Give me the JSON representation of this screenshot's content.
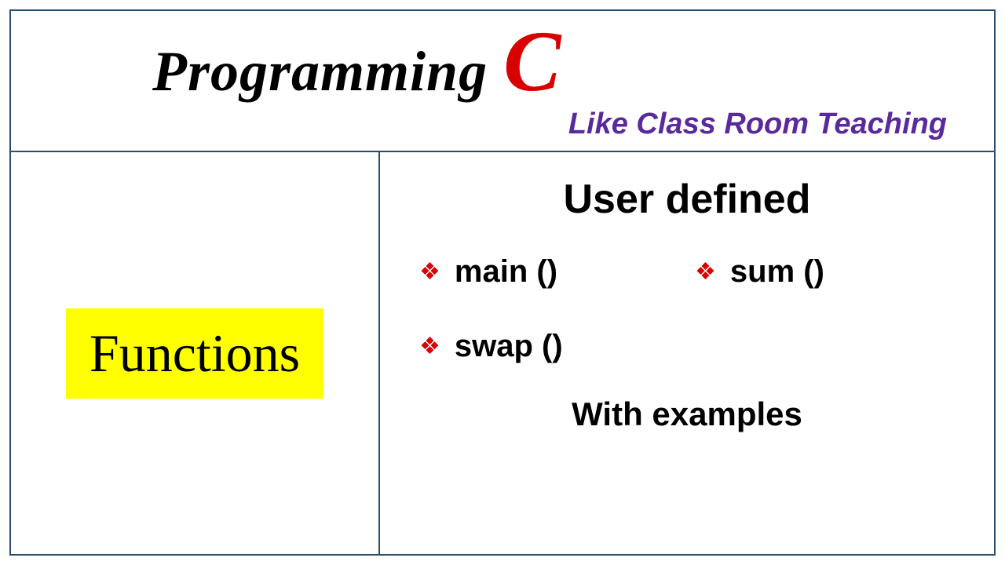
{
  "header": {
    "title_main": "Programming",
    "title_lang": "C",
    "subtitle": "Like Class Room Teaching"
  },
  "left": {
    "topic": "Functions"
  },
  "right": {
    "heading": "User defined",
    "bullets": [
      "main ()",
      "sum ()",
      "swap ()"
    ],
    "footer": "With examples"
  }
}
